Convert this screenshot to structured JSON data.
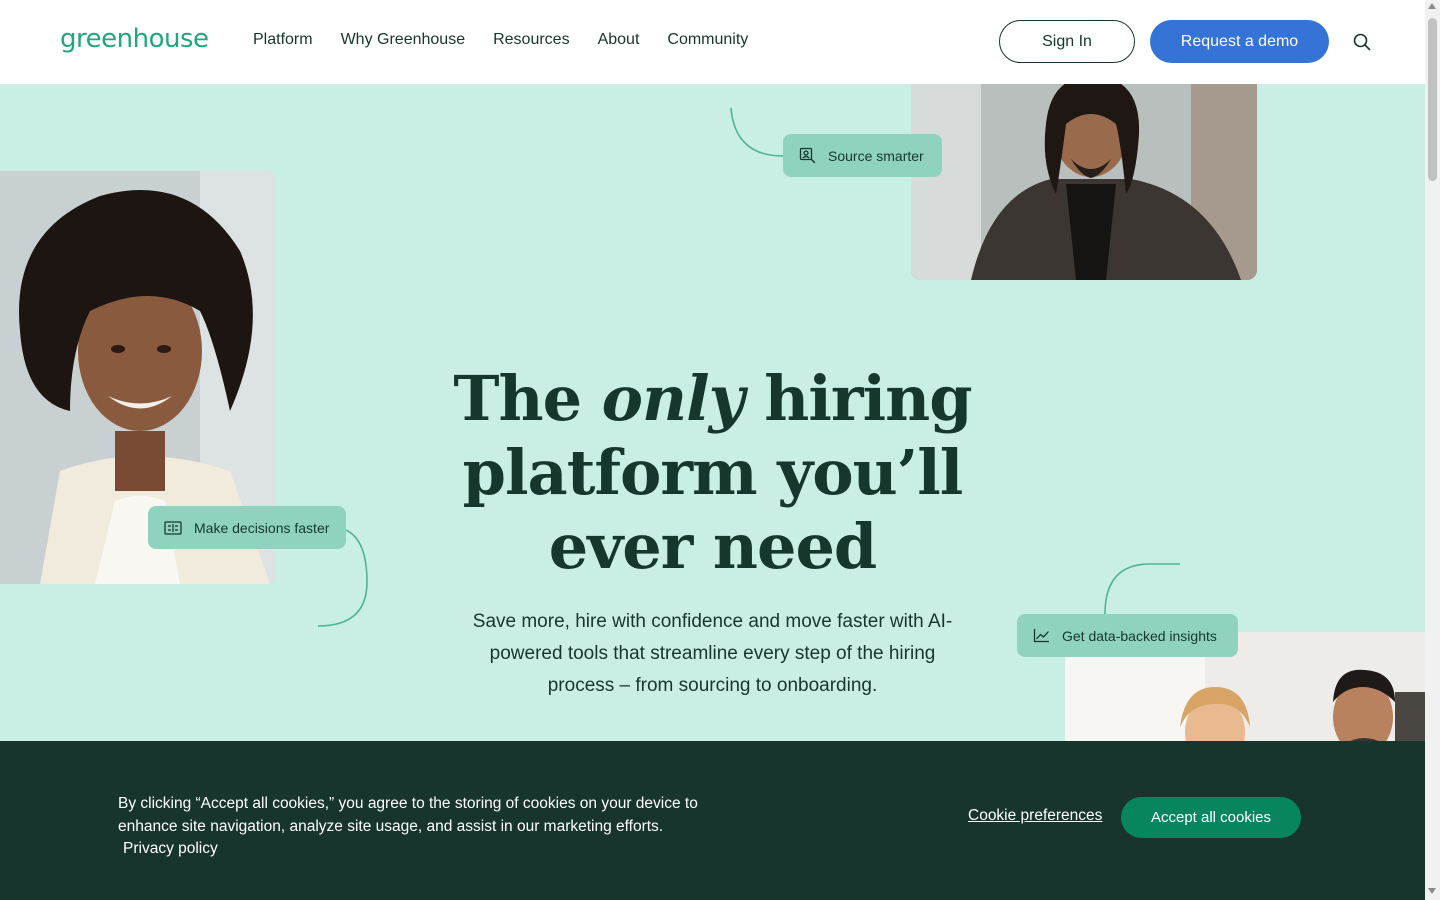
{
  "header": {
    "logo": "greenhouse",
    "nav": [
      {
        "label": "Platform"
      },
      {
        "label": "Why Greenhouse"
      },
      {
        "label": "Resources"
      },
      {
        "label": "About"
      },
      {
        "label": "Community"
      }
    ],
    "sign_in_label": "Sign In",
    "demo_label": "Request a demo",
    "search_icon": "search-icon"
  },
  "hero": {
    "headline_part1": "The ",
    "headline_em": "only",
    "headline_part2": " hiring platform you’ll ever need",
    "subhead": "Save more, hire with confidence and move faster with AI-powered tools that streamline every step of the hiring process – from sourcing to onboarding.",
    "tags": {
      "source": {
        "label": "Source smarter",
        "icon": "person-search-icon"
      },
      "decisions": {
        "label": "Make decisions faster",
        "icon": "compare-icon"
      },
      "insights": {
        "label": "Get data-backed insights",
        "icon": "trend-chart-icon"
      }
    }
  },
  "cookie_banner": {
    "text": "By clicking “Accept all cookies,” you agree to the storing of cookies on your device to enhance site navigation, analyze site usage, and assist in our marketing efforts.",
    "privacy_label": "Privacy policy",
    "preferences_label": "Cookie preferences",
    "accept_label": "Accept all cookies"
  },
  "colors": {
    "brand_green": "#24a47f",
    "hero_bg": "#c9efe5",
    "tag_bg": "#8fd3bf",
    "dark_green": "#15372c",
    "cta_blue": "#3574d6",
    "cookie_bg": "#17342d",
    "accept_green": "#07855f"
  }
}
